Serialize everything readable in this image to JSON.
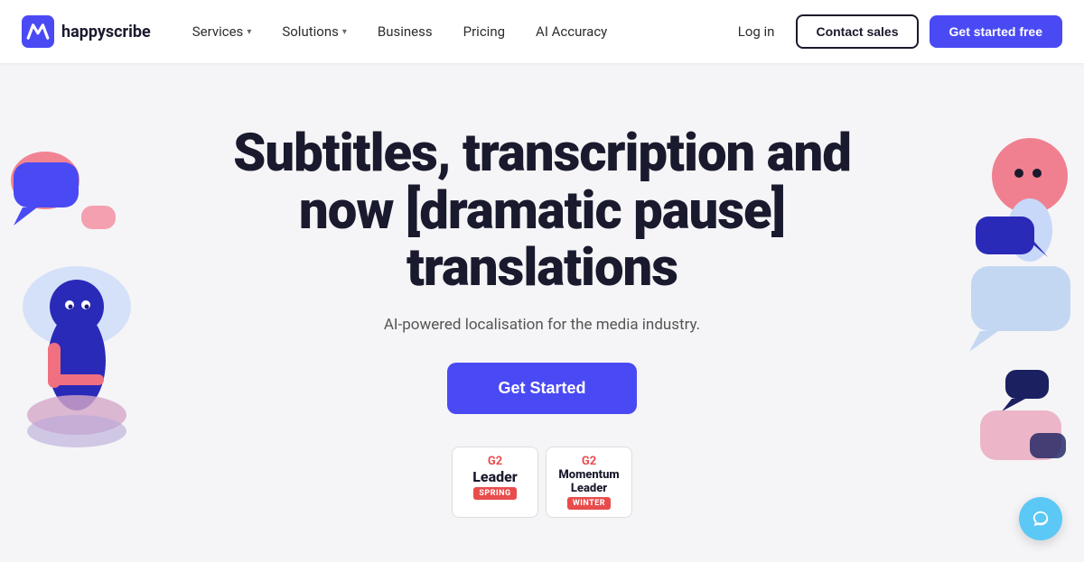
{
  "brand": {
    "name": "happyscribe",
    "logo_alt": "HappyScribe logo"
  },
  "nav": {
    "links": [
      {
        "label": "Services",
        "has_dropdown": true
      },
      {
        "label": "Solutions",
        "has_dropdown": true
      },
      {
        "label": "Business",
        "has_dropdown": false
      },
      {
        "label": "Pricing",
        "has_dropdown": false
      },
      {
        "label": "AI Accuracy",
        "has_dropdown": false
      }
    ],
    "login_label": "Log in",
    "contact_label": "Contact sales",
    "get_started_label": "Get started free"
  },
  "hero": {
    "title": "Subtitles, transcription and now [dramatic pause] translations",
    "subtitle": "AI-powered localisation for the media industry.",
    "cta_label": "Get Started"
  },
  "badges": [
    {
      "g2": "G2",
      "title": "Leader",
      "season": "SPRING"
    },
    {
      "g2": "G2",
      "title": "Momentum Leader",
      "season": "WINTER"
    }
  ],
  "chat": {
    "icon": "chat-bubble"
  }
}
